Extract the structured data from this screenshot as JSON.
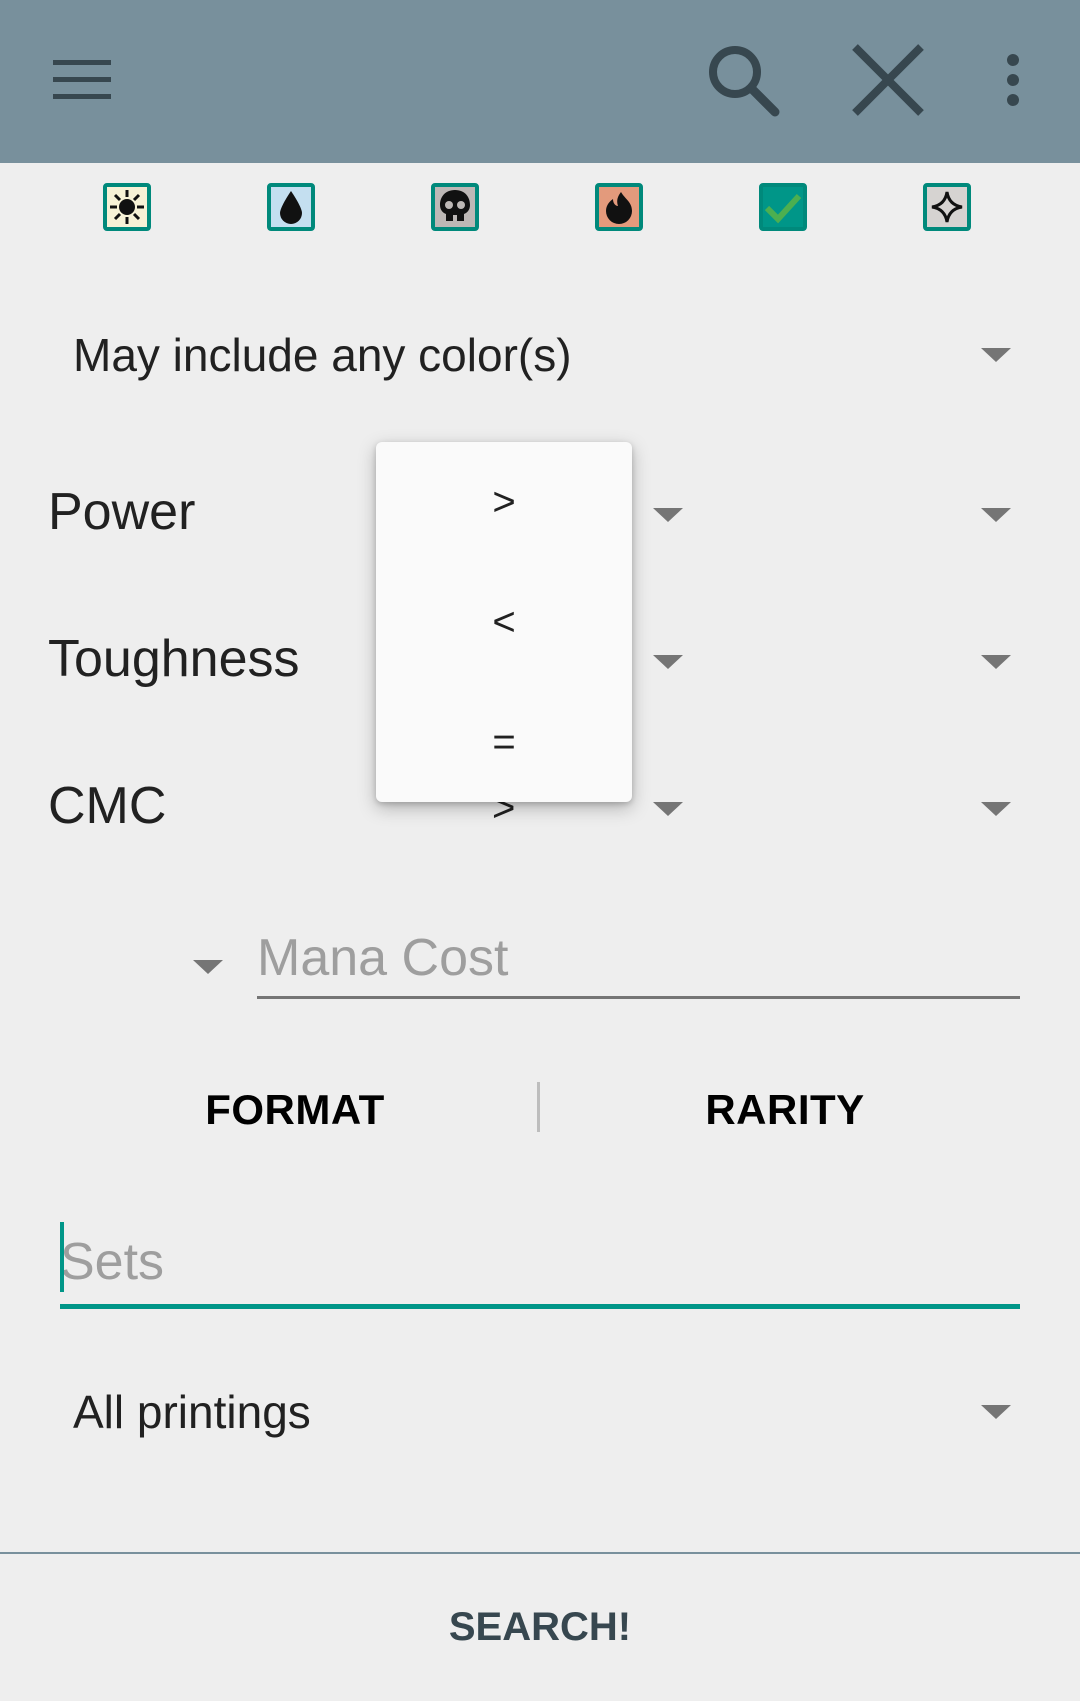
{
  "colors": {
    "toolbar_bg": "#78909c",
    "accent": "#009688",
    "background": "#eeeeee"
  },
  "toolbar": {
    "menu_icon": "hamburger-icon",
    "search_icon": "search-icon",
    "clear_icon": "close-icon",
    "overflow_icon": "more-vert-icon"
  },
  "color_filters": [
    {
      "name": "white",
      "icon": "sun-icon",
      "checked": false
    },
    {
      "name": "blue",
      "icon": "water-drop-icon",
      "checked": false
    },
    {
      "name": "black",
      "icon": "skull-icon",
      "checked": false
    },
    {
      "name": "red",
      "icon": "fire-icon",
      "checked": false
    },
    {
      "name": "green",
      "icon": "check-icon",
      "checked": true
    },
    {
      "name": "colorless",
      "icon": "diamond-icon",
      "checked": false
    }
  ],
  "color_mode": {
    "selected": "May include any color(s)"
  },
  "rows": {
    "power": {
      "label": "Power"
    },
    "toughness": {
      "label": "Toughness"
    },
    "cmc": {
      "label": "CMC",
      "operator": ">"
    }
  },
  "operator_popup": {
    "options": [
      ">",
      "<",
      "="
    ]
  },
  "mana_cost": {
    "placeholder": "Mana Cost"
  },
  "tabs": {
    "format": "FORMAT",
    "rarity": "RARITY"
  },
  "sets": {
    "placeholder": "Sets"
  },
  "printings": {
    "selected": "All printings"
  },
  "search_button": {
    "label": "SEARCH!"
  }
}
